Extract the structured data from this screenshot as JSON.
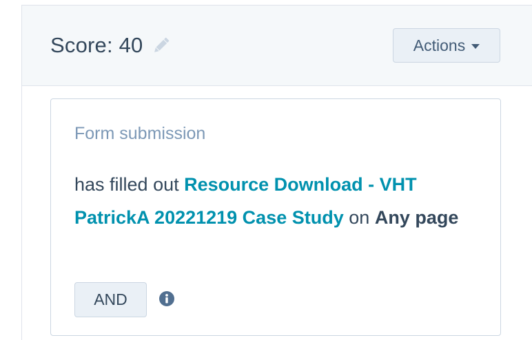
{
  "header": {
    "score_label": "Score: 40",
    "actions_label": "Actions"
  },
  "card": {
    "title": "Form submission",
    "prefix": "has filled out",
    "form_name": "Resource Download - VHT PatrickA 20221219 Case Study",
    "connector": "on",
    "page_value": "Any page",
    "and_label": "AND"
  },
  "icons": {
    "edit": "pencil-icon",
    "dropdown": "caret-down-icon",
    "info": "info-icon"
  },
  "colors": {
    "link": "#0091ae",
    "text": "#33475b",
    "muted": "#7c98b6",
    "header_bg": "#f5f8fa",
    "button_bg": "#eaf0f6",
    "border": "#cbd6e2"
  }
}
